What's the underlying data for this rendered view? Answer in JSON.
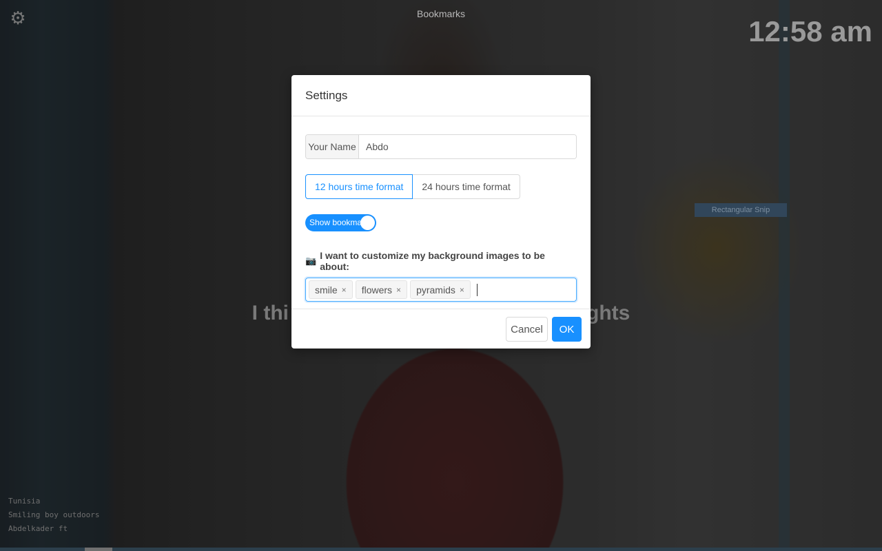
{
  "header": {
    "title": "Bookmarks",
    "clock": "12:58 am"
  },
  "background": {
    "quote_left": "I thi",
    "quote_right": "ghts",
    "snip_label": "Rectangular Snip",
    "credits": [
      "Tunisia",
      "Smiling boy outdoors",
      "Abdelkader ft"
    ]
  },
  "modal": {
    "title": "Settings",
    "name_field": {
      "label": "Your Name",
      "value": "Abdo"
    },
    "time_format": {
      "options": [
        "12 hours time format",
        "24 hours time format"
      ],
      "selected": "12 hours time format"
    },
    "bookmarks_toggle": {
      "label": "Show bookmarks",
      "on": true
    },
    "customize": {
      "label": "I want to customize my background images to be about:",
      "tags": [
        "smile",
        "flowers",
        "pyramids"
      ]
    },
    "buttons": {
      "cancel": "Cancel",
      "ok": "OK"
    }
  },
  "colors": {
    "accent": "#1890ff"
  }
}
